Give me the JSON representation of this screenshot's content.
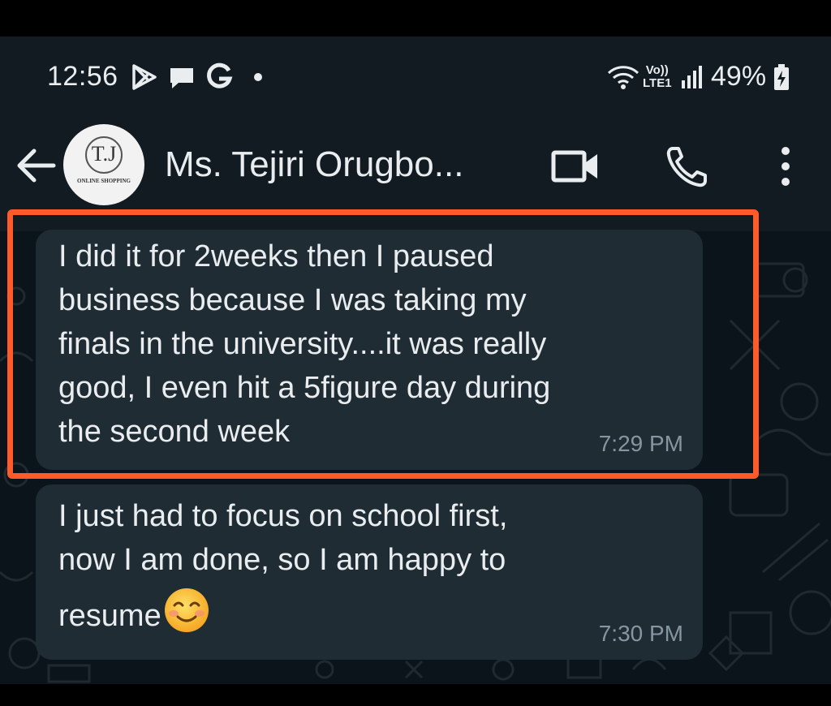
{
  "statusbar": {
    "time": "12:56",
    "battery_percent": "49%",
    "network_label_top": "Vo))",
    "network_label_bottom": "LTE1",
    "notification_icons": [
      "play-store-icon",
      "chat-bubble-icon",
      "google-g-icon",
      "dot-icon"
    ],
    "system_icons": [
      "wifi-icon",
      "volte-icon",
      "signal-bars-icon",
      "battery-charging-icon"
    ]
  },
  "header": {
    "contact_name": "Ms. Tejiri Orugbo...",
    "avatar_logo_text": "T.J",
    "avatar_subtext": "ONLINE SHOPPING",
    "actions": [
      "video-call-icon",
      "voice-call-icon",
      "more-options-icon"
    ]
  },
  "messages": [
    {
      "text": "I did it for 2weeks then I paused\nbusiness because I was taking my\nfinals in the university....it was really\ngood, I even hit a 5figure day during\nthe second week",
      "time": "7:29 PM",
      "highlighted": true
    },
    {
      "text_lines": [
        "I just had to focus on school first,",
        "now I am done, so I am happy to",
        "resume"
      ],
      "emoji": "smiling-face-with-smiling-eyes",
      "time": "7:30 PM"
    }
  ],
  "colors": {
    "background": "#0b141a",
    "bubble": "#202c33",
    "highlight_border": "#ff5a2a",
    "timestamp": "#8696a0",
    "text": "#e9edef"
  }
}
